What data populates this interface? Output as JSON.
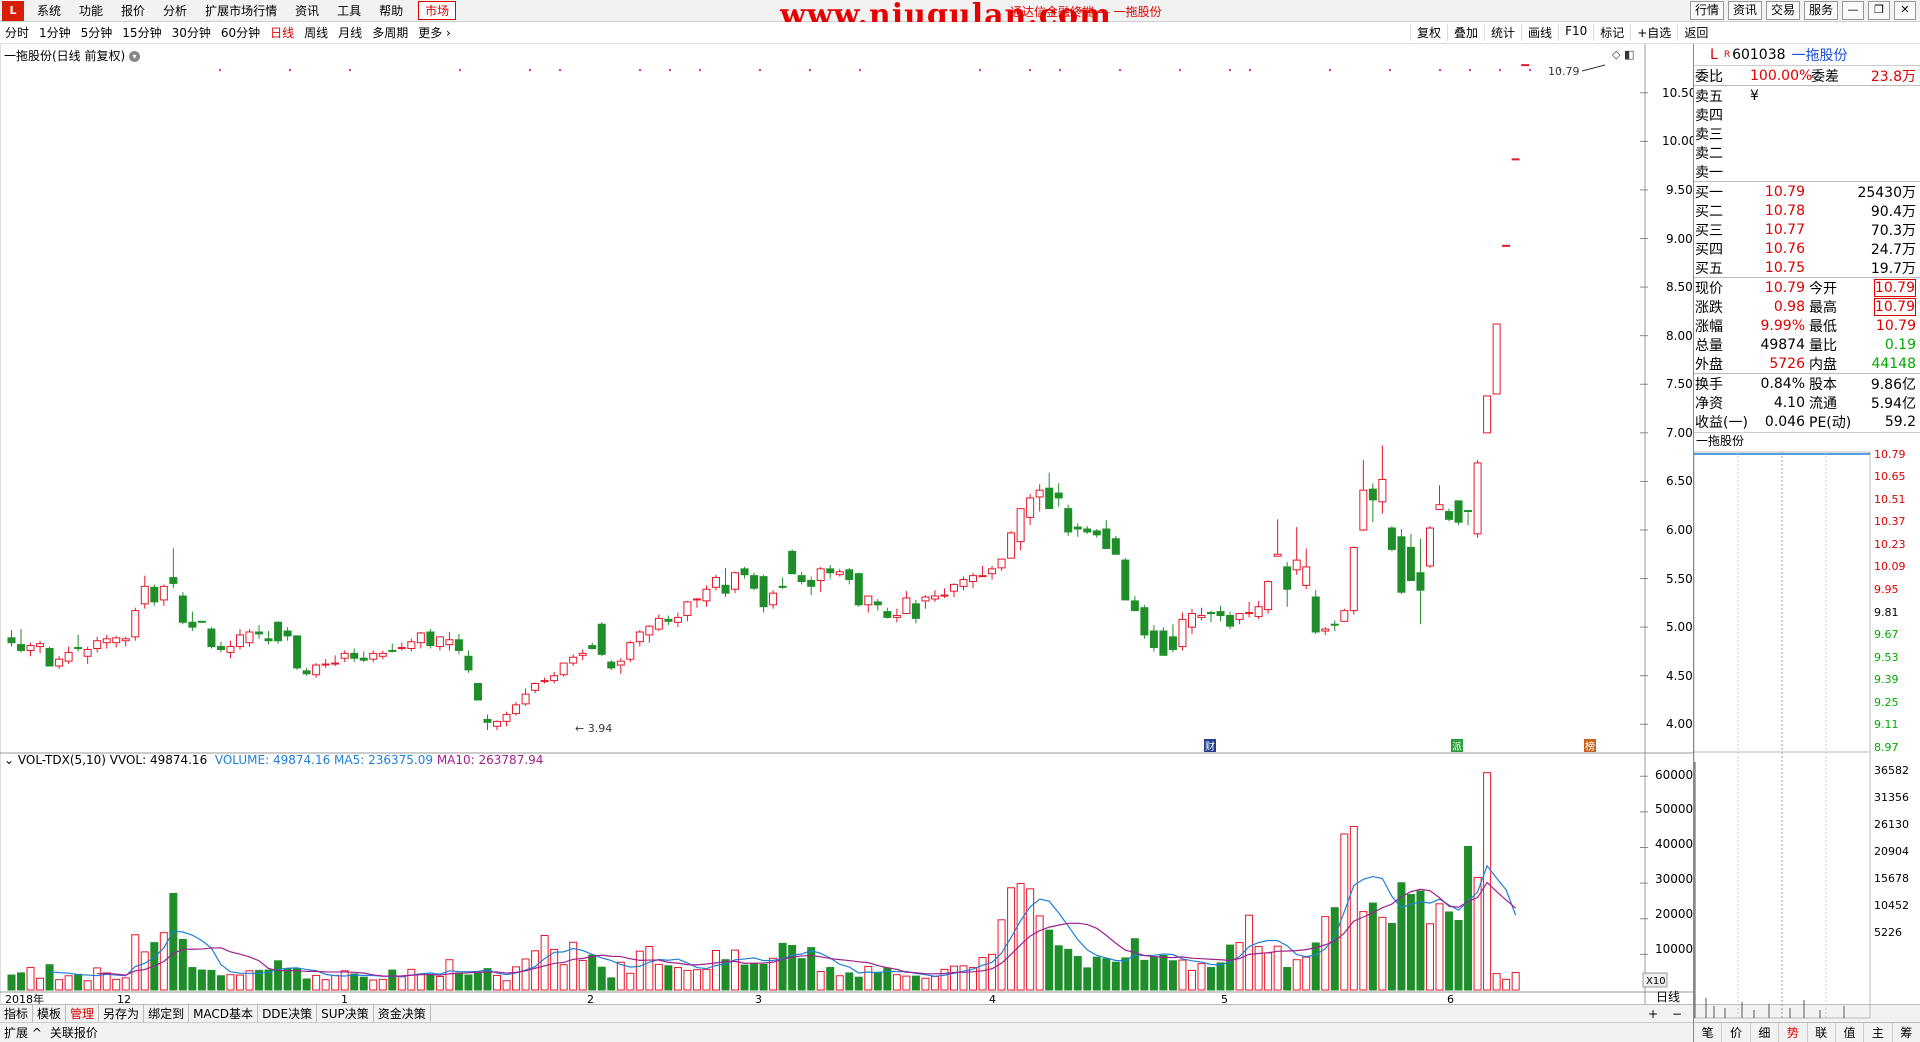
{
  "app": {
    "logo": "L",
    "window_title": "通达信金融终端 — 一拖股份",
    "watermark": "www.niugulan.com"
  },
  "menu": [
    "系统",
    "功能",
    "报价",
    "分析",
    "扩展市场行情",
    "资讯",
    "工具",
    "帮助"
  ],
  "menu_active": "市场",
  "topright": [
    "行情",
    "资讯",
    "交易",
    "服务"
  ],
  "periods": [
    "分时",
    "1分钟",
    "5分钟",
    "15分钟",
    "30分钟",
    "60分钟",
    "日线",
    "周线",
    "月线",
    "多周期",
    "更多"
  ],
  "period_active": "日线",
  "tools": [
    "复权",
    "叠加",
    "统计",
    "画线",
    "F10",
    "标记",
    "+自选",
    "返回"
  ],
  "chart_title": "一拖股份(日线 前复权)",
  "price_axis": [
    "10.50",
    "10.00",
    "9.50",
    "9.00",
    "8.50",
    "8.00",
    "7.50",
    "7.00",
    "6.50",
    "6.00",
    "5.50",
    "5.00",
    "4.50",
    "4.00"
  ],
  "high_label": "10.79",
  "low_label": "3.94",
  "event_markers": [
    "财",
    "派",
    "榜"
  ],
  "vol_legend": {
    "name": "VOL-TDX(5,10)",
    "vvol": "VVOL: 49874.16",
    "volume": "VOLUME: 49874.16",
    "ma5": "MA5: 236375.09",
    "ma10": "MA10: 263787.94"
  },
  "vol_axis": [
    "60000",
    "50000",
    "40000",
    "30000",
    "20000",
    "10000"
  ],
  "vol_unit": "X10",
  "date_axis": [
    "2018年",
    "12",
    "1",
    "2",
    "3",
    "4",
    "5",
    "6"
  ],
  "period_label": "日线",
  "bottom_tabs": [
    "指标",
    "模板",
    "管理",
    "另存为",
    "绑定到",
    "MACD基本",
    "DDE决策",
    "SUP决策",
    "资金决策"
  ],
  "bottom_active": "管理",
  "bottom2": [
    "扩展",
    "关联报价"
  ],
  "colors": {
    "up": "#e8162a",
    "down": "#1f8e2a",
    "ma5": "#1e7fd8",
    "ma10": "#a0208e"
  },
  "chart_data": {
    "type": "candlestick",
    "candles": [
      [
        4.89,
        4.97,
        4.8,
        4.84
      ],
      [
        4.82,
        4.98,
        4.74,
        4.76
      ],
      [
        4.76,
        4.84,
        4.7,
        4.81
      ],
      [
        4.8,
        4.86,
        4.73,
        4.83
      ],
      [
        4.78,
        4.8,
        4.6,
        4.6
      ],
      [
        4.6,
        4.7,
        4.57,
        4.67
      ],
      [
        4.65,
        4.8,
        4.62,
        4.74
      ],
      [
        4.79,
        4.92,
        4.75,
        4.78
      ],
      [
        4.7,
        4.8,
        4.62,
        4.77
      ],
      [
        4.78,
        4.9,
        4.74,
        4.86
      ],
      [
        4.84,
        4.92,
        4.78,
        4.88
      ],
      [
        4.84,
        4.91,
        4.79,
        4.89
      ],
      [
        4.86,
        4.9,
        4.8,
        4.88
      ],
      [
        4.9,
        5.2,
        4.86,
        5.17
      ],
      [
        5.24,
        5.53,
        5.19,
        5.42
      ],
      [
        5.41,
        5.44,
        5.22,
        5.26
      ],
      [
        5.28,
        5.44,
        5.22,
        5.42
      ],
      [
        5.51,
        5.81,
        5.4,
        5.45
      ],
      [
        5.32,
        5.36,
        5.03,
        5.05
      ],
      [
        5.05,
        5.16,
        4.96,
        5.0
      ],
      [
        5.06,
        5.06,
        5.05,
        5.05
      ],
      [
        4.98,
        5.0,
        4.78,
        4.8
      ],
      [
        4.8,
        4.85,
        4.74,
        4.77
      ],
      [
        4.74,
        4.86,
        4.68,
        4.8
      ],
      [
        4.8,
        4.98,
        4.77,
        4.92
      ],
      [
        4.84,
        4.98,
        4.8,
        4.95
      ],
      [
        4.95,
        5.02,
        4.88,
        4.93
      ],
      [
        4.88,
        4.96,
        4.82,
        4.86
      ],
      [
        5.05,
        5.06,
        4.83,
        4.86
      ],
      [
        4.96,
        5.0,
        4.86,
        4.91
      ],
      [
        4.91,
        4.91,
        4.56,
        4.58
      ],
      [
        4.55,
        4.58,
        4.5,
        4.52
      ],
      [
        4.51,
        4.63,
        4.48,
        4.61
      ],
      [
        4.61,
        4.67,
        4.58,
        4.62
      ],
      [
        4.63,
        4.71,
        4.6,
        4.63
      ],
      [
        4.68,
        4.76,
        4.64,
        4.73
      ],
      [
        4.73,
        4.78,
        4.64,
        4.68
      ],
      [
        4.68,
        4.75,
        4.64,
        4.66
      ],
      [
        4.67,
        4.76,
        4.64,
        4.73
      ],
      [
        4.7,
        4.76,
        4.67,
        4.73
      ],
      [
        4.76,
        4.83,
        4.74,
        4.75
      ],
      [
        4.79,
        4.84,
        4.76,
        4.79
      ],
      [
        4.78,
        4.88,
        4.75,
        4.85
      ],
      [
        4.84,
        4.95,
        4.78,
        4.94
      ],
      [
        4.95,
        4.98,
        4.78,
        4.81
      ],
      [
        4.8,
        4.9,
        4.76,
        4.9
      ],
      [
        4.82,
        4.95,
        4.76,
        4.87
      ],
      [
        4.87,
        4.93,
        4.72,
        4.76
      ],
      [
        4.7,
        4.76,
        4.53,
        4.56
      ],
      [
        4.42,
        4.42,
        4.27,
        4.25
      ],
      [
        4.05,
        4.1,
        3.94,
        4.02
      ],
      [
        3.98,
        4.04,
        3.94,
        4.03
      ],
      [
        4.03,
        4.13,
        3.98,
        4.1
      ],
      [
        4.11,
        4.23,
        4.09,
        4.2
      ],
      [
        4.21,
        4.37,
        4.19,
        4.31
      ],
      [
        4.35,
        4.43,
        4.32,
        4.42
      ],
      [
        4.44,
        4.48,
        4.42,
        4.45
      ],
      [
        4.45,
        4.54,
        4.42,
        4.5
      ],
      [
        4.51,
        4.63,
        4.49,
        4.63
      ],
      [
        4.63,
        4.72,
        4.6,
        4.69
      ],
      [
        4.71,
        4.77,
        4.66,
        4.73
      ],
      [
        4.81,
        4.84,
        4.77,
        4.78
      ],
      [
        5.03,
        5.05,
        4.7,
        4.72
      ],
      [
        4.64,
        4.66,
        4.56,
        4.58
      ],
      [
        4.61,
        4.68,
        4.52,
        4.65
      ],
      [
        4.67,
        4.86,
        4.64,
        4.84
      ],
      [
        4.85,
        4.97,
        4.8,
        4.95
      ],
      [
        4.92,
        5.02,
        4.84,
        5.01
      ],
      [
        4.98,
        5.13,
        4.96,
        5.09
      ],
      [
        5.08,
        5.12,
        5.02,
        5.06
      ],
      [
        5.05,
        5.15,
        5.0,
        5.1
      ],
      [
        5.12,
        5.27,
        5.06,
        5.26
      ],
      [
        5.28,
        5.3,
        5.2,
        5.29
      ],
      [
        5.27,
        5.43,
        5.21,
        5.39
      ],
      [
        5.41,
        5.54,
        5.38,
        5.51
      ],
      [
        5.43,
        5.61,
        5.31,
        5.35
      ],
      [
        5.39,
        5.57,
        5.35,
        5.56
      ],
      [
        5.6,
        5.62,
        5.5,
        5.54
      ],
      [
        5.53,
        5.56,
        5.38,
        5.4
      ],
      [
        5.52,
        5.54,
        5.15,
        5.21
      ],
      [
        5.23,
        5.38,
        5.19,
        5.35
      ],
      [
        5.42,
        5.51,
        5.39,
        5.41
      ],
      [
        5.78,
        5.8,
        5.56,
        5.55
      ],
      [
        5.53,
        5.57,
        5.44,
        5.47
      ],
      [
        5.48,
        5.52,
        5.33,
        5.42
      ],
      [
        5.48,
        5.62,
        5.36,
        5.6
      ],
      [
        5.6,
        5.64,
        5.5,
        5.56
      ],
      [
        5.54,
        5.6,
        5.52,
        5.57
      ],
      [
        5.59,
        5.61,
        5.44,
        5.49
      ],
      [
        5.55,
        5.56,
        5.21,
        5.23
      ],
      [
        5.23,
        5.32,
        5.15,
        5.32
      ],
      [
        5.26,
        5.29,
        5.17,
        5.23
      ],
      [
        5.16,
        5.2,
        5.09,
        5.1
      ],
      [
        5.1,
        5.19,
        5.05,
        5.12
      ],
      [
        5.14,
        5.37,
        5.14,
        5.3
      ],
      [
        5.24,
        5.28,
        5.04,
        5.09
      ],
      [
        5.27,
        5.33,
        5.19,
        5.31
      ],
      [
        5.29,
        5.38,
        5.26,
        5.32
      ],
      [
        5.32,
        5.4,
        5.3,
        5.33
      ],
      [
        5.37,
        5.45,
        5.31,
        5.44
      ],
      [
        5.42,
        5.52,
        5.38,
        5.49
      ],
      [
        5.47,
        5.56,
        5.4,
        5.53
      ],
      [
        5.53,
        5.63,
        5.52,
        5.53
      ],
      [
        5.55,
        5.63,
        5.49,
        5.6
      ],
      [
        5.61,
        5.7,
        5.58,
        5.7
      ],
      [
        5.71,
        5.99,
        5.71,
        5.97
      ],
      [
        5.88,
        6.22,
        5.79,
        6.22
      ],
      [
        6.13,
        6.37,
        6.05,
        6.33
      ],
      [
        6.34,
        6.47,
        6.19,
        6.41
      ],
      [
        6.43,
        6.59,
        6.29,
        6.22
      ],
      [
        6.38,
        6.48,
        6.24,
        6.33
      ],
      [
        6.22,
        6.26,
        5.94,
        5.98
      ],
      [
        6.03,
        6.07,
        5.93,
        6.01
      ],
      [
        6.01,
        6.04,
        5.96,
        5.98
      ],
      [
        5.99,
        6.01,
        5.92,
        5.95
      ],
      [
        6.01,
        6.1,
        5.82,
        5.81
      ],
      [
        5.91,
        5.94,
        5.75,
        5.75
      ],
      [
        5.69,
        5.71,
        5.28,
        5.28
      ],
      [
        5.27,
        5.32,
        5.2,
        5.17
      ],
      [
        5.2,
        5.23,
        4.88,
        4.92
      ],
      [
        4.96,
        5.02,
        4.75,
        4.79
      ],
      [
        4.96,
        5.0,
        4.76,
        4.71
      ],
      [
        4.9,
        5.03,
        4.74,
        4.77
      ],
      [
        4.8,
        5.15,
        4.76,
        5.08
      ],
      [
        5.0,
        5.19,
        4.93,
        5.14
      ],
      [
        5.1,
        5.2,
        5.07,
        5.12
      ],
      [
        5.15,
        5.17,
        5.05,
        5.14
      ],
      [
        5.16,
        5.22,
        5.06,
        5.12
      ],
      [
        5.12,
        5.16,
        4.98,
        5.01
      ],
      [
        5.08,
        5.14,
        5.03,
        5.14
      ],
      [
        5.15,
        5.26,
        5.1,
        5.15
      ],
      [
        5.11,
        5.27,
        5.08,
        5.21
      ],
      [
        5.18,
        5.48,
        5.14,
        5.47
      ],
      [
        5.73,
        6.11,
        5.74,
        5.75
      ],
      [
        5.62,
        5.67,
        5.21,
        5.39
      ],
      [
        5.59,
        6.03,
        5.54,
        5.69
      ],
      [
        5.43,
        5.81,
        5.39,
        5.62
      ],
      [
        5.31,
        5.38,
        4.93,
        4.95
      ],
      [
        4.96,
        5.0,
        4.92,
        4.98
      ],
      [
        5.03,
        5.07,
        4.96,
        5.02
      ],
      [
        5.06,
        5.19,
        5.06,
        5.17
      ],
      [
        5.17,
        5.83,
        5.13,
        5.82
      ],
      [
        6.0,
        6.72,
        5.99,
        6.41
      ],
      [
        6.42,
        6.48,
        6.08,
        6.31
      ],
      [
        6.29,
        6.87,
        6.17,
        6.52
      ],
      [
        6.02,
        6.04,
        5.78,
        5.8
      ],
      [
        5.93,
        6.01,
        5.34,
        5.36
      ],
      [
        5.82,
        5.96,
        5.54,
        5.48
      ],
      [
        5.56,
        5.91,
        5.03,
        5.38
      ],
      [
        5.63,
        6.04,
        5.61,
        6.02
      ],
      [
        6.21,
        6.46,
        6.22,
        6.26
      ],
      [
        6.19,
        6.22,
        6.09,
        6.11
      ],
      [
        6.3,
        6.2,
        6.05,
        6.08
      ],
      [
        6.2,
        6.18,
        6.05,
        6.19
      ],
      [
        5.96,
        6.72,
        5.92,
        6.69
      ],
      [
        7.0,
        7.37,
        7.0,
        7.38
      ],
      [
        7.4,
        8.12,
        7.4,
        8.12
      ],
      [
        8.93,
        8.93,
        8.93,
        8.93
      ],
      [
        9.82,
        9.82,
        9.82,
        9.82
      ],
      [
        10.79,
        10.79,
        10.79,
        10.79
      ]
    ],
    "volumes": [
      4200,
      4800,
      6300,
      3300,
      7100,
      2900,
      4000,
      4400,
      2600,
      6200,
      4800,
      3000,
      3400,
      15500,
      10700,
      13300,
      16100,
      27100,
      14200,
      6300,
      5600,
      5500,
      4000,
      4300,
      4200,
      5400,
      5500,
      5600,
      8200,
      5900,
      5900,
      3100,
      4100,
      2900,
      4100,
      5400,
      4500,
      3600,
      2800,
      3000,
      5600,
      3700,
      5800,
      4500,
      4300,
      3800,
      8500,
      4800,
      4200,
      4700,
      6000,
      4100,
      2600,
      6500,
      8700,
      11000,
      15300,
      11400,
      7100,
      13400,
      8300,
      9800,
      6400,
      3400,
      7800,
      4700,
      10900,
      12200,
      7200,
      6800,
      6300,
      5500,
      5700,
      5800,
      11100,
      8500,
      11200,
      7000,
      7300,
      7200,
      8900,
      13100,
      12500,
      8800,
      11900,
      5200,
      6300,
      4000,
      4800,
      3600,
      6600,
      5000,
      6200,
      4300,
      3900,
      3900,
      3300,
      3800,
      5800,
      6700,
      6800,
      6300,
      9100,
      10000,
      19700,
      28700,
      29900,
      28400,
      20800,
      16800,
      12400,
      11400,
      9400,
      6200,
      9200,
      8800,
      7800,
      9000,
      14400,
      8300,
      9200,
      9700,
      8200,
      8400,
      5500,
      7400,
      6300,
      7600,
      12600,
      13300,
      21000,
      12200,
      10400,
      12300,
      6300,
      8500,
      9200,
      13200,
      20600,
      23100,
      43800,
      45900,
      22000,
      24400,
      20400,
      18700,
      30100,
      26800,
      27800,
      18600,
      24200,
      21900,
      19500,
      40300,
      31600,
      61000,
      4600,
      3000,
      4900
    ],
    "price_range": [
      3.9,
      10.92
    ],
    "x_dates": [
      "2018年",
      "12",
      "1",
      "2",
      "3",
      "4",
      "5",
      "6"
    ],
    "volume_unit": "X10"
  },
  "quote": {
    "code": "601038",
    "name": "一拖股份",
    "wb_label": "委比",
    "wb": "100.00%",
    "wc_label": "委差",
    "wc": "23.8万",
    "asks": [
      {
        "l": "卖五",
        "p": "¥",
        "v": ""
      },
      {
        "l": "卖四",
        "p": "",
        "v": ""
      },
      {
        "l": "卖三",
        "p": "",
        "v": ""
      },
      {
        "l": "卖二",
        "p": "",
        "v": ""
      },
      {
        "l": "卖一",
        "p": "",
        "v": ""
      }
    ],
    "bids": [
      {
        "l": "买一",
        "p": "10.79",
        "v": "25430万"
      },
      {
        "l": "买二",
        "p": "10.78",
        "v": "90.4万"
      },
      {
        "l": "买三",
        "p": "10.77",
        "v": "70.3万"
      },
      {
        "l": "买四",
        "p": "10.76",
        "v": "24.7万"
      },
      {
        "l": "买五",
        "p": "10.75",
        "v": "19.7万"
      }
    ],
    "stats": [
      {
        "l1": "现价",
        "v1": "10.79",
        "c1": "red",
        "l2": "今开",
        "v2": "10.79",
        "c2": "red",
        "b2": true
      },
      {
        "l1": "涨跌",
        "v1": "0.98",
        "c1": "red",
        "l2": "最高",
        "v2": "10.79",
        "c2": "red",
        "b2": true
      },
      {
        "l1": "涨幅",
        "v1": "9.99%",
        "c1": "red",
        "l2": "最低",
        "v2": "10.79",
        "c2": "red",
        "b2": false
      },
      {
        "l1": "总量",
        "v1": "49874",
        "c1": "black",
        "l2": "量比",
        "v2": "0.19",
        "c2": "green",
        "b2": false
      },
      {
        "l1": "外盘",
        "v1": "5726",
        "c1": "red",
        "l2": "内盘",
        "v2": "44148",
        "c2": "green",
        "b2": false
      }
    ],
    "stats2": [
      {
        "l1": "换手",
        "v1": "0.84%",
        "l2": "股本",
        "v2": "9.86亿"
      },
      {
        "l1": "净资",
        "v1": "4.10",
        "l2": "流通",
        "v2": "5.94亿"
      },
      {
        "l1": "收益(一)",
        "v1": "0.046",
        "l2": "PE(动)",
        "v2": "59.2"
      }
    ],
    "mini_title": "一拖股份",
    "mini_price_axis": [
      "10.79",
      "10.65",
      "10.51",
      "10.37",
      "10.23",
      "10.09",
      "9.95",
      "9.81",
      "9.67",
      "9.53",
      "9.39",
      "9.25",
      "9.11",
      "8.97"
    ],
    "mini_vol_axis": [
      "36582",
      "31356",
      "26130",
      "20904",
      "15678",
      "10452",
      "5226"
    ],
    "tabs": [
      "笔",
      "价",
      "细",
      "势",
      "联",
      "值",
      "主",
      "筹"
    ],
    "tab_active": "势"
  }
}
